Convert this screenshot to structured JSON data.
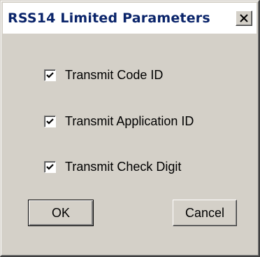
{
  "dialog": {
    "title": "RSS14 Limited Parameters",
    "close_label": "X"
  },
  "options": [
    {
      "label": "Transmit Code ID",
      "checked": true
    },
    {
      "label": "Transmit Application ID",
      "checked": true
    },
    {
      "label": "Transmit Check Digit",
      "checked": true
    }
  ],
  "buttons": {
    "ok_label": "OK",
    "cancel_label": "Cancel"
  },
  "icons": {
    "close": "close-x-icon",
    "check": "checkmark-icon"
  },
  "colors": {
    "dialog_bg": "#d4d0c8",
    "title_text": "#0a246a",
    "title_bg": "#ffffff"
  }
}
